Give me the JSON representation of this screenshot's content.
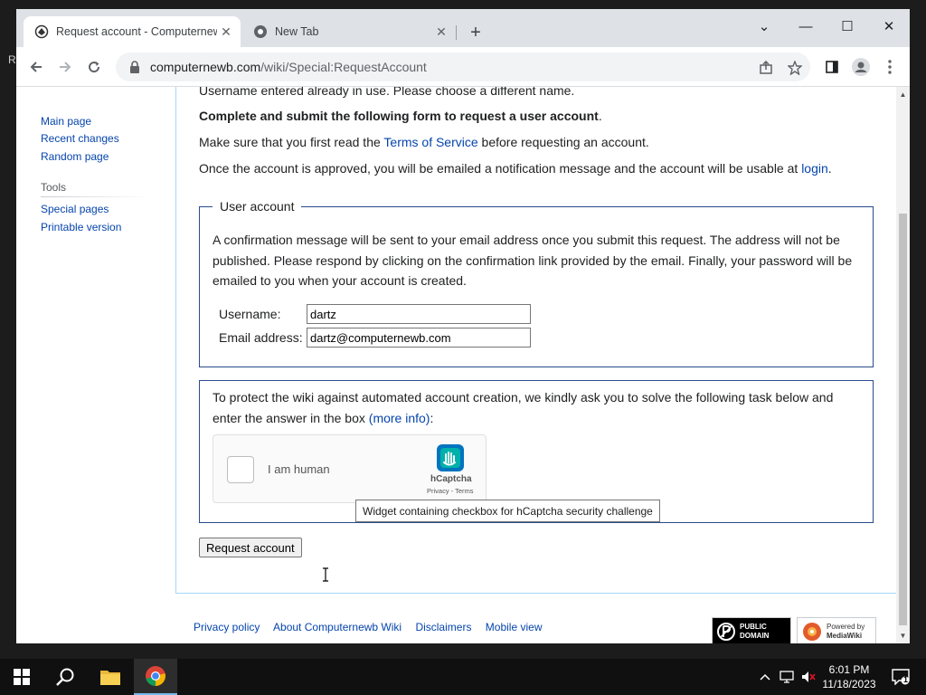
{
  "desktop": {
    "edge_letter": "R"
  },
  "tabs": [
    {
      "title": "Request account - Computernewb Wiki",
      "close": "✕"
    },
    {
      "title": "New Tab",
      "close": "✕"
    }
  ],
  "new_tab_glyph": "+",
  "window_controls": {
    "dropdown": "⌄",
    "minimize": "—",
    "maximize": "☐",
    "close": "✕"
  },
  "address_bar": {
    "host": "computernewb.com",
    "path": "/wiki/Special:RequestAccount"
  },
  "sidebar": {
    "nav": [
      "Main page",
      "Recent changes",
      "Random page"
    ],
    "tools_heading": "Tools",
    "tools": [
      "Special pages",
      "Printable version"
    ]
  },
  "page": {
    "error_line": "Username entered already in use. Please choose a different name.",
    "instruction_bold": "Complete and submit the following form to request a user account",
    "instruction_end": ".",
    "tos_prefix": "Make sure that you first read the ",
    "tos_link": "Terms of Service",
    "tos_suffix": " before requesting an account.",
    "approve_prefix": "Once the account is approved, you will be emailed a notification message and the account will be usable at ",
    "approve_link": "login",
    "approve_suffix": "."
  },
  "user_account": {
    "legend": "User account",
    "description": "A confirmation message will be sent to your email address once you submit this request. The address will not be published. Please respond by clicking on the confirmation link provided by the email. Finally, your password will be emailed to you when your account is created.",
    "username_label": "Username:",
    "username_value": "dartz",
    "email_label": "Email address:",
    "email_value": "dartz@computernewb.com"
  },
  "captcha": {
    "text_prefix": "To protect the wiki against automated account creation, we kindly ask you to solve the following task below and enter the answer in the box ",
    "more_info": "(more info)",
    "text_suffix": ":",
    "checkbox_label": "I am human",
    "brand": "hCaptcha",
    "links": "Privacy - Terms",
    "tooltip": "Widget containing checkbox for hCaptcha security challenge"
  },
  "submit_label": "Request account",
  "footer": {
    "links": [
      "Privacy policy",
      "About Computernewb Wiki",
      "Disclaimers",
      "Mobile view"
    ],
    "badge_pd": "PUBLIC DOMAIN",
    "badge_mw_top": "Powered by",
    "badge_mw_bottom": "MediaWiki"
  },
  "clock": {
    "time": "6:01 PM",
    "date": "11/18/2023"
  },
  "notification_count": "1",
  "colors": {
    "link": "#0645ad",
    "fieldset_border": "#2a4b8d",
    "tabstrip": "#dee1e6",
    "taskbar": "#101010"
  }
}
